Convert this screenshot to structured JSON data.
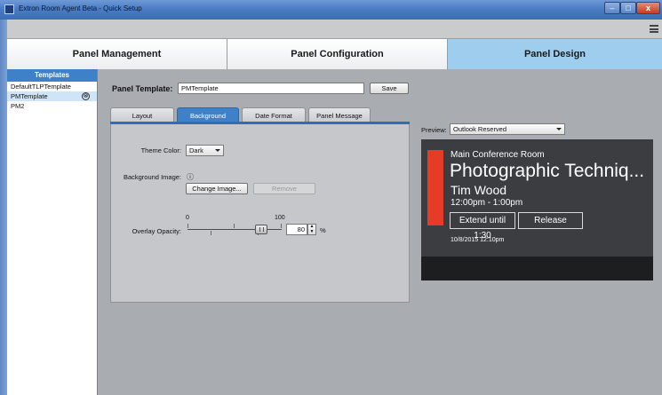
{
  "window": {
    "title": "Extron Room Agent Beta - Quick Setup"
  },
  "main_tabs": [
    {
      "label": "Panel Management"
    },
    {
      "label": "Panel Configuration"
    },
    {
      "label": "Panel Design",
      "selected": true
    }
  ],
  "sidebar": {
    "header": "Templates",
    "items": [
      {
        "label": "DefaultTLPTemplate"
      },
      {
        "label": "PMTemplate",
        "selected": true
      },
      {
        "label": "PM2"
      }
    ],
    "delete_icon_glyph": "⊗"
  },
  "panel_template": {
    "label": "Panel Template:",
    "value": "PMTemplate",
    "save_label": "Save"
  },
  "sub_tabs": [
    {
      "label": "Layout"
    },
    {
      "label": "Background",
      "selected": true
    },
    {
      "label": "Date Format"
    },
    {
      "label": "Panel Message"
    }
  ],
  "background": {
    "theme_color_label": "Theme Color:",
    "theme_color_value": "Dark",
    "background_image_label": "Background Image:",
    "info_icon": "ⓘ",
    "change_image_label": "Change Image...",
    "remove_label": "Remove",
    "overlay_opacity_label": "Overlay Opacity:",
    "slider_min_label": "0",
    "slider_max_label": "100",
    "overlay_opacity_value": "80",
    "overlay_opacity_fraction": 0.8,
    "percent_sign": "%"
  },
  "preview": {
    "label": "Preview:",
    "selected_option": "Outlook Reserved",
    "room_name": "Main Conference Room",
    "meeting_title": "Photographic Techniq...",
    "organizer": "Tim Wood",
    "time_range": "12:00pm - 1:00pm",
    "extend_label": "Extend until 1:30",
    "release_label": "Release",
    "datetime": "10/8/2015 12:10pm",
    "status_color": "#e63b27"
  },
  "colors": {
    "accent_blue": "#3f81c9",
    "selected_tab": "#9fcdee"
  }
}
